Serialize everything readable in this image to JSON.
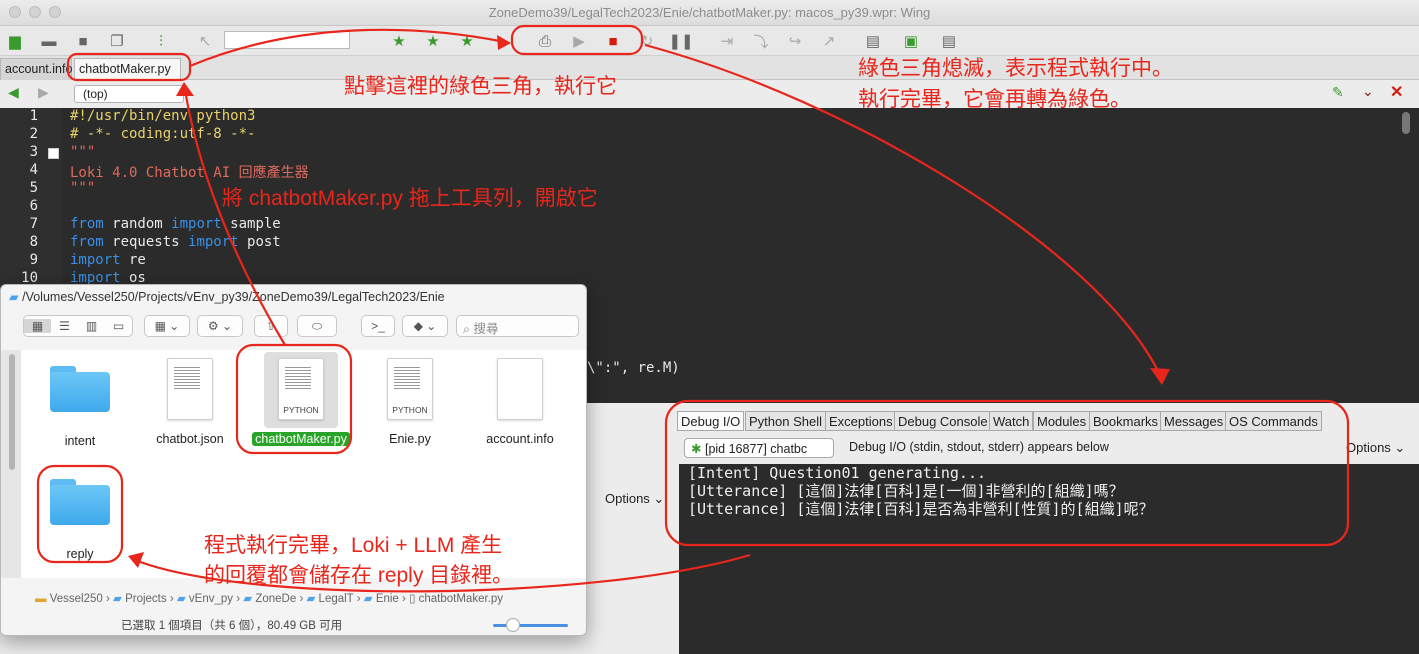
{
  "window": {
    "title": "ZoneDemo39/LegalTech2023/Enie/chatbotMaker.py: macos_py39.wpr: Wing"
  },
  "tabs": [
    {
      "label": "account.info"
    },
    {
      "label": "chatbotMaker.py"
    }
  ],
  "nav": {
    "scope": "(top)"
  },
  "editor": {
    "line_numbers": [
      "1",
      "2",
      "3",
      "4",
      "5",
      "6",
      "7",
      "8",
      "9",
      "10"
    ],
    "lines": [
      "#!/usr/bin/env python3",
      "# -*- coding:utf-8 -*-",
      "\"\"\"",
      "Loki 4.0 Chatbot AI 回應產生器",
      "\"\"\"",
      "",
      "from random import sample",
      "from requests import post",
      "import re",
      "import os"
    ],
    "kw_from": "from",
    "kw_import": "import",
    "partial_line": "\\\":\", re.M)"
  },
  "debug": {
    "tabs": [
      "Debug I/O",
      "Python Shell",
      "Exceptions",
      "Debug Console",
      "Watch",
      "Modules",
      "Bookmarks",
      "Messages",
      "OS Commands"
    ],
    "process": "[pid 16877] chatbc",
    "info": "Debug I/O (stdin, stdout, stderr) appears below",
    "options": "Options",
    "output": [
      "[Intent] Question01 generating...",
      "[Utterance] [這個]法律[百科]是[一個]非營利的[組織]嗎？",
      "[Utterance] [這個]法律[百科]是否為非營利[性質]的[組織]呢？"
    ]
  },
  "lower_left": {
    "options": "Options"
  },
  "finder": {
    "path": "/Volumes/Vessel250/Projects/vEnv_py39/ZoneDemo39/LegalTech2023/Enie",
    "search_placeholder": "搜尋",
    "items": [
      {
        "name": "intent",
        "kind": "folder"
      },
      {
        "name": "chatbot.json",
        "kind": "file"
      },
      {
        "name": "chatbotMaker.py",
        "kind": "python"
      },
      {
        "name": "Enie.py",
        "kind": "python"
      },
      {
        "name": "account.info",
        "kind": "file"
      },
      {
        "name": "reply",
        "kind": "folder"
      }
    ],
    "python_label": "PYTHON",
    "breadcrumb": [
      "Vessel250",
      "Projects",
      "vEnv_py",
      "ZoneDe",
      "LegalT",
      "Enie",
      "chatbotMaker.py"
    ],
    "status": "已選取 1 個項目（共 6 個），80.49 GB 可用"
  },
  "annotations": {
    "run": "點擊這裡的綠色三角，執行它",
    "running_1": "綠色三角熄滅，表示程式執行中。",
    "running_2": "執行完畢，它會再轉為綠色。",
    "drag": "將 chatbotMaker.py 拖上工具列，開啟它",
    "done_1": "程式執行完畢，Loki + LLM 產生",
    "done_2": "的回覆都會儲存在 reply 目錄裡。"
  },
  "colors": {
    "annotation": "#e8261b",
    "editor_bg": "#2b2b2b",
    "keyword": "#3a8fe8",
    "selection": "#28a528"
  }
}
